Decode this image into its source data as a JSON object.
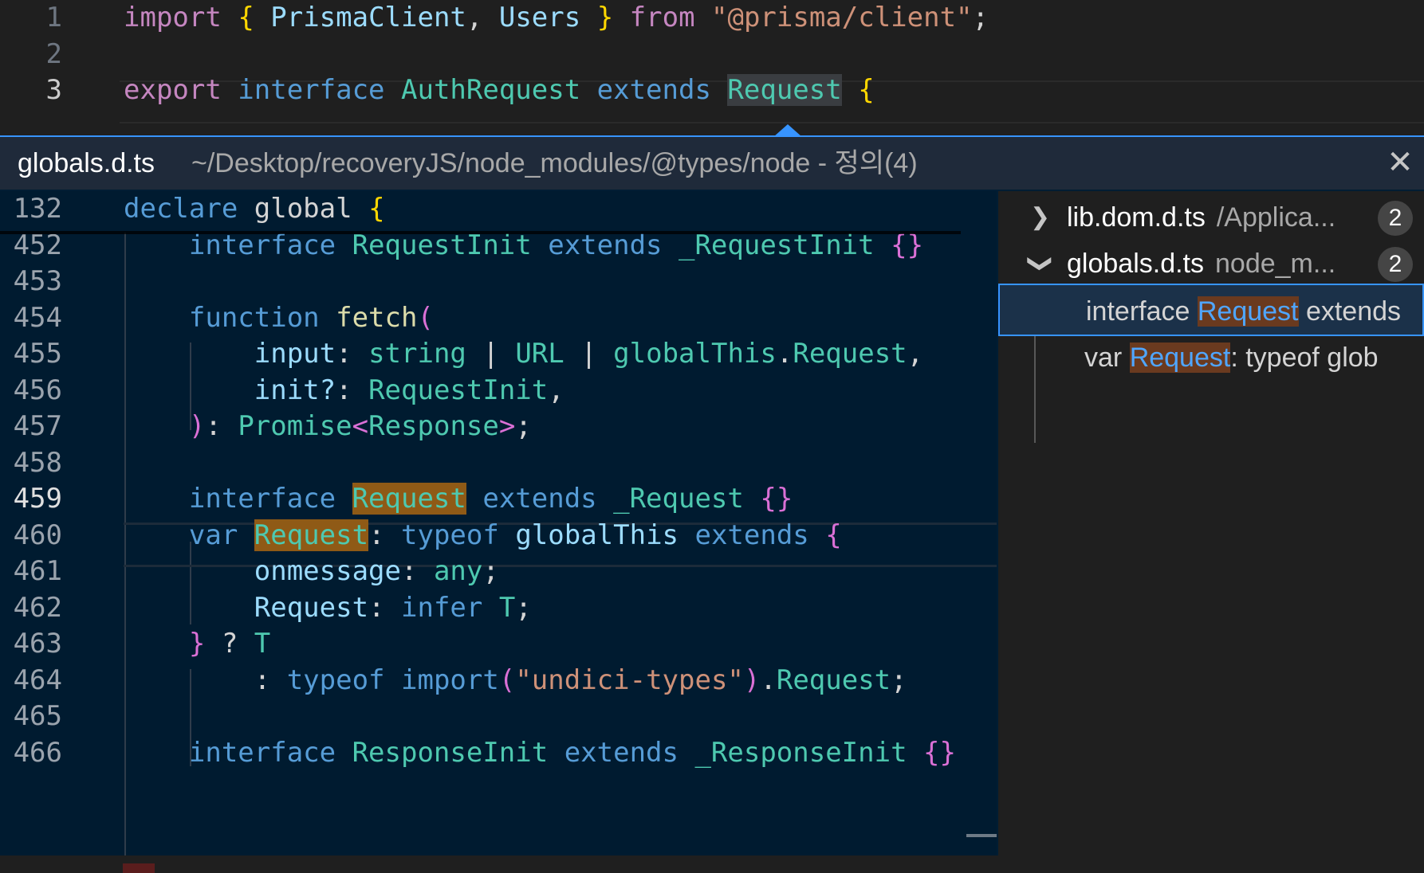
{
  "editor": {
    "lines": [
      {
        "num": "1",
        "tokens": [
          {
            "t": "import",
            "c": "kw"
          },
          {
            "t": " ",
            "c": "pl"
          },
          {
            "t": "{",
            "c": "br1"
          },
          {
            "t": " PrismaClient",
            "c": "va"
          },
          {
            "t": ",",
            "c": "pl"
          },
          {
            "t": " Users",
            "c": "va"
          },
          {
            "t": " ",
            "c": "pl"
          },
          {
            "t": "}",
            "c": "br1"
          },
          {
            "t": " from ",
            "c": "kw"
          },
          {
            "t": "\"@prisma/client\"",
            "c": "st"
          },
          {
            "t": ";",
            "c": "pl"
          }
        ]
      },
      {
        "num": "2",
        "tokens": []
      },
      {
        "num": "3",
        "active": true,
        "tokens": [
          {
            "t": "export",
            "c": "kw"
          },
          {
            "t": " interface ",
            "c": "kwb"
          },
          {
            "t": "AuthRequest",
            "c": "ty"
          },
          {
            "t": " extends ",
            "c": "kwb"
          },
          {
            "t": "Request",
            "c": "ty hl-top"
          },
          {
            "t": " ",
            "c": "pl"
          },
          {
            "t": "{",
            "c": "br1"
          }
        ]
      }
    ]
  },
  "peek": {
    "file": "globals.d.ts",
    "path": "~/Desktop/recoveryJS/node_modules/@types/node - 정의(4)",
    "close_icon": "close-icon",
    "code": [
      {
        "num": "132",
        "tokens": [
          {
            "t": "declare",
            "c": "kwb"
          },
          {
            "t": " global ",
            "c": "pl"
          },
          {
            "t": "{",
            "c": "br1"
          }
        ]
      },
      {
        "num": "452",
        "tokens": [
          {
            "t": "    interface ",
            "c": "kwb"
          },
          {
            "t": "RequestInit",
            "c": "ty"
          },
          {
            "t": " extends ",
            "c": "kwb"
          },
          {
            "t": "_RequestInit",
            "c": "ty"
          },
          {
            "t": " ",
            "c": "pl"
          },
          {
            "t": "{}",
            "c": "br2"
          }
        ]
      },
      {
        "num": "453",
        "tokens": []
      },
      {
        "num": "454",
        "tokens": [
          {
            "t": "    function ",
            "c": "kwb"
          },
          {
            "t": "fetch",
            "c": "fn"
          },
          {
            "t": "(",
            "c": "br2"
          }
        ]
      },
      {
        "num": "455",
        "tokens": [
          {
            "t": "        input",
            "c": "va"
          },
          {
            "t": ": ",
            "c": "pl"
          },
          {
            "t": "string",
            "c": "ty"
          },
          {
            "t": " | ",
            "c": "pl"
          },
          {
            "t": "URL",
            "c": "ty"
          },
          {
            "t": " | ",
            "c": "pl"
          },
          {
            "t": "globalThis",
            "c": "ty"
          },
          {
            "t": ".",
            "c": "pl"
          },
          {
            "t": "Request",
            "c": "ty"
          },
          {
            "t": ",",
            "c": "pl"
          }
        ]
      },
      {
        "num": "456",
        "tokens": [
          {
            "t": "        init?",
            "c": "va"
          },
          {
            "t": ": ",
            "c": "pl"
          },
          {
            "t": "RequestInit",
            "c": "ty"
          },
          {
            "t": ",",
            "c": "pl"
          }
        ]
      },
      {
        "num": "457",
        "tokens": [
          {
            "t": "    )",
            "c": "br2"
          },
          {
            "t": ": ",
            "c": "pl"
          },
          {
            "t": "Promise",
            "c": "ty"
          },
          {
            "t": "<",
            "c": "br2"
          },
          {
            "t": "Response",
            "c": "ty"
          },
          {
            "t": ">",
            "c": "br2"
          },
          {
            "t": ";",
            "c": "pl"
          }
        ]
      },
      {
        "num": "458",
        "tokens": []
      },
      {
        "num": "459",
        "active": true,
        "tokens": [
          {
            "t": "    interface ",
            "c": "kwb"
          },
          {
            "t": "Request",
            "c": "ty hl-peek"
          },
          {
            "t": " extends ",
            "c": "kwb"
          },
          {
            "t": "_Request",
            "c": "ty"
          },
          {
            "t": " ",
            "c": "pl"
          },
          {
            "t": "{}",
            "c": "br2"
          }
        ]
      },
      {
        "num": "460",
        "tokens": [
          {
            "t": "    var ",
            "c": "kwb"
          },
          {
            "t": "Request",
            "c": "ty hl-peek"
          },
          {
            "t": ": ",
            "c": "pl"
          },
          {
            "t": "typeof ",
            "c": "kwb"
          },
          {
            "t": "globalThis",
            "c": "va"
          },
          {
            "t": " extends ",
            "c": "kwb"
          },
          {
            "t": "{",
            "c": "br2"
          }
        ]
      },
      {
        "num": "461",
        "tokens": [
          {
            "t": "        onmessage",
            "c": "va"
          },
          {
            "t": ": ",
            "c": "pl"
          },
          {
            "t": "any",
            "c": "ty"
          },
          {
            "t": ";",
            "c": "pl"
          }
        ]
      },
      {
        "num": "462",
        "tokens": [
          {
            "t": "        Request",
            "c": "va"
          },
          {
            "t": ": ",
            "c": "pl"
          },
          {
            "t": "infer ",
            "c": "kwb"
          },
          {
            "t": "T",
            "c": "ty"
          },
          {
            "t": ";",
            "c": "pl"
          }
        ]
      },
      {
        "num": "463",
        "tokens": [
          {
            "t": "    }",
            "c": "br2"
          },
          {
            "t": " ? ",
            "c": "pl"
          },
          {
            "t": "T",
            "c": "ty"
          }
        ]
      },
      {
        "num": "464",
        "tokens": [
          {
            "t": "        : ",
            "c": "pl"
          },
          {
            "t": "typeof ",
            "c": "kwb"
          },
          {
            "t": "import",
            "c": "kwb"
          },
          {
            "t": "(",
            "c": "br2"
          },
          {
            "t": "\"undici-types\"",
            "c": "st"
          },
          {
            "t": ")",
            "c": "br2"
          },
          {
            "t": ".",
            "c": "pl"
          },
          {
            "t": "Request",
            "c": "ty"
          },
          {
            "t": ";",
            "c": "pl"
          }
        ]
      },
      {
        "num": "465",
        "tokens": []
      },
      {
        "num": "466",
        "tokens": [
          {
            "t": "    interface ",
            "c": "kwb"
          },
          {
            "t": "ResponseInit",
            "c": "ty"
          },
          {
            "t": " extends ",
            "c": "kwb"
          },
          {
            "t": "_ResponseInit",
            "c": "ty"
          },
          {
            "t": " ",
            "c": "pl"
          },
          {
            "t": "{}",
            "c": "br2"
          }
        ]
      }
    ],
    "tree": {
      "groups": [
        {
          "file": "lib.dom.d.ts",
          "path": "/Applica...",
          "count": "2",
          "expanded": false
        },
        {
          "file": "globals.d.ts",
          "path": "node_m...",
          "count": "2",
          "expanded": true
        }
      ],
      "refs": [
        {
          "before": "interface ",
          "match": "Request",
          "after": " extends",
          "selected": true
        },
        {
          "before": "var ",
          "match": "Request",
          "after": ": typeof glob",
          "selected": false
        }
      ]
    }
  },
  "colors": {
    "accent": "#3794ff",
    "peek_bg": "#001b30",
    "match_hl": "#8f5a16"
  }
}
